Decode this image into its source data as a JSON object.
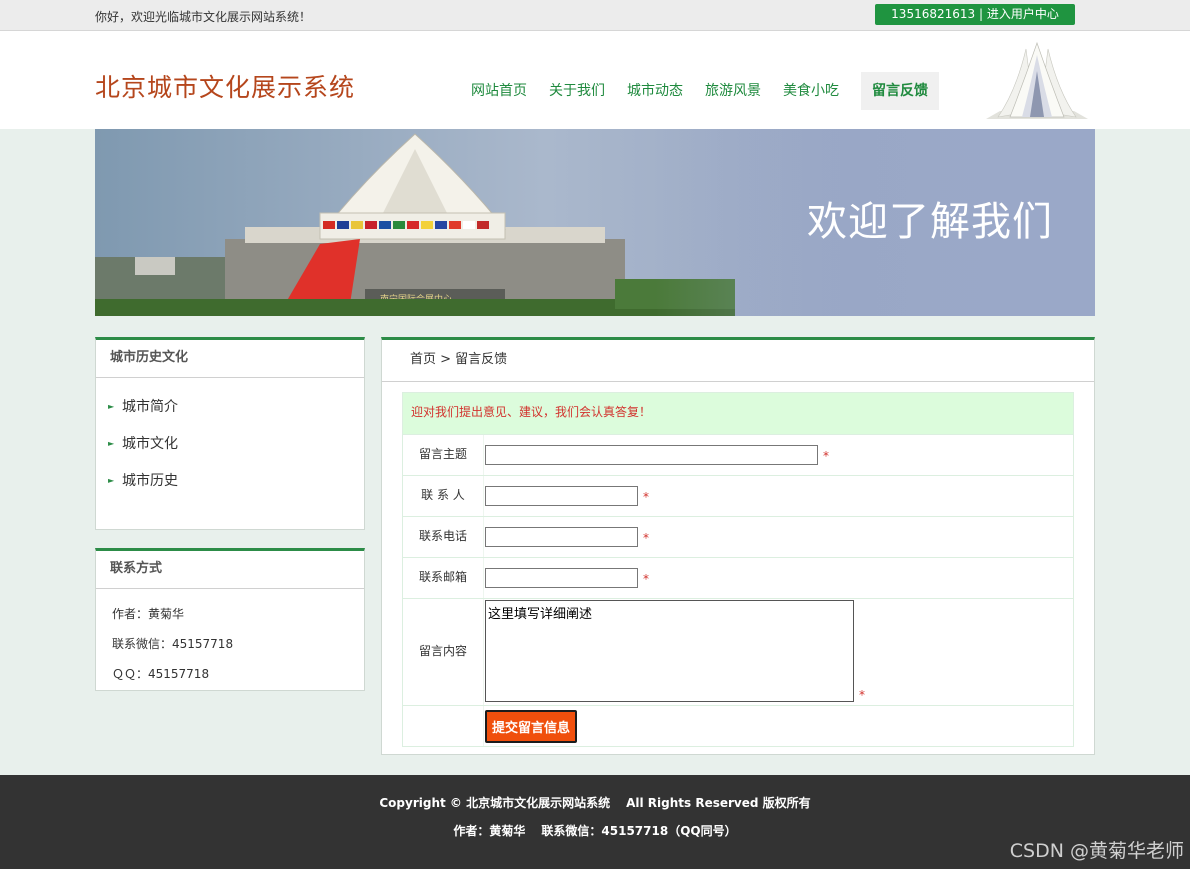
{
  "topbar": {
    "welcome": "你好，欢迎光临城市文化展示网站系统！",
    "user_link": "13516821613 | 进入用户中心"
  },
  "header": {
    "site_title": "北京城市文化展示系统",
    "nav": [
      "网站首页",
      "关于我们",
      "城市动态",
      "旅游风景",
      "美食小吃",
      "留言反馈"
    ],
    "active_nav": "留言反馈"
  },
  "banner": {
    "caption": "欢迎了解我们",
    "sign_text": "南宁国际会展中心"
  },
  "history": {
    "title": "城市历史文化",
    "items": [
      "城市简介",
      "城市文化",
      "城市历史"
    ]
  },
  "contact": {
    "title": "联系方式",
    "lines": [
      "作者：黄菊华",
      "联系微信：45157718",
      "ＱＱ：45157718"
    ]
  },
  "main": {
    "breadcrumb": "首页 > 留言反馈",
    "tip": "迎对我们提出意见、建议，我们会认真答复！",
    "form": {
      "subject_label": "留言主题",
      "contact_label": "联 系 人",
      "phone_label": "联系电话",
      "email_label": "联系邮箱",
      "content_label": "留言内容",
      "content_value": "这里填写详细阐述",
      "required_mark": "*",
      "submit_label": "提交留言信息"
    }
  },
  "footer": {
    "copyright": "Copyright © 北京城市文化展示网站系统",
    "rights": "All Rights Reserved 版权所有",
    "author": "作者：黄菊华",
    "wechat": "联系微信：45157718（QQ同号）"
  },
  "watermark": "CSDN @黄菊华老师",
  "colors": {
    "accent_green": "#2c8c47",
    "nav_green": "#1f8a3e",
    "title_red": "#b5461c",
    "submit_orange": "#f04f0c",
    "footer_bg": "#333333"
  }
}
